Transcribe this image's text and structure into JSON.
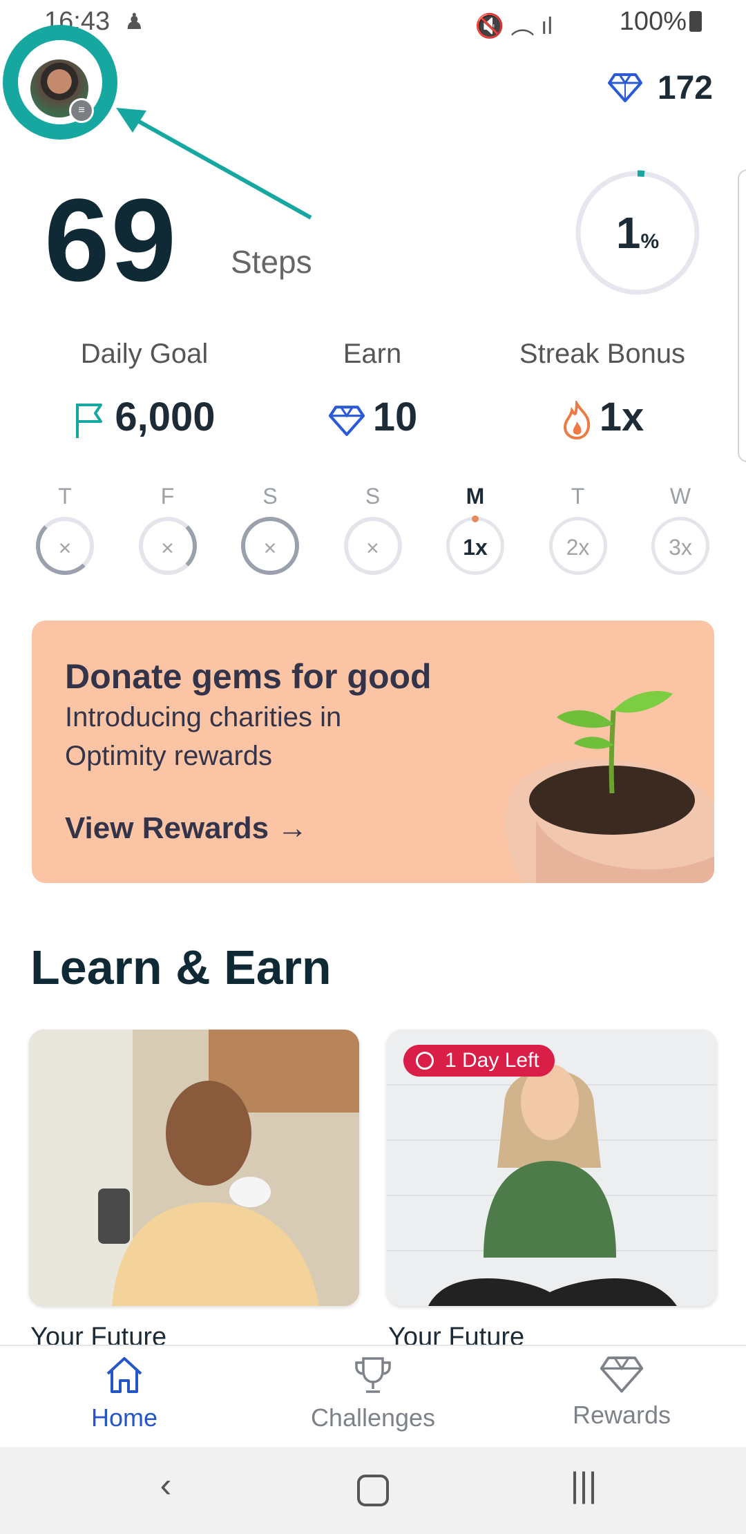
{
  "status_bar": {
    "time": "16:43",
    "battery": "100%"
  },
  "header": {
    "gems": "172"
  },
  "steps": {
    "count": "69",
    "label": "Steps",
    "progress_value": "1",
    "progress_unit": "%",
    "progress_fraction": 0.01
  },
  "stats": [
    {
      "label": "Daily Goal",
      "value": "6,000",
      "icon": "flag-icon"
    },
    {
      "label": "Earn",
      "value": "10",
      "icon": "gem-icon"
    },
    {
      "label": "Streak Bonus",
      "value": "1x",
      "icon": "flame-icon"
    }
  ],
  "week": [
    {
      "letter": "T",
      "mark": "×"
    },
    {
      "letter": "F",
      "mark": "×"
    },
    {
      "letter": "S",
      "mark": "×"
    },
    {
      "letter": "S",
      "mark": "×"
    },
    {
      "letter": "M",
      "mark": "1x"
    },
    {
      "letter": "T",
      "mark": "2x"
    },
    {
      "letter": "W",
      "mark": "3x"
    }
  ],
  "banner": {
    "title": "Donate gems for good",
    "subtitle": "Introducing charities in Optimity rewards",
    "cta": "View Rewards →"
  },
  "learn": {
    "title": "Learn & Earn",
    "cards": [
      {
        "caption": "Your Future"
      },
      {
        "caption": "Your Future",
        "badge": "1 Day Left"
      }
    ]
  },
  "nav": {
    "home": "Home",
    "challenges": "Challenges",
    "rewards": "Rewards"
  },
  "colors": {
    "teal": "#16a7a1",
    "nav_active": "#2456c7",
    "banner_bg": "#fbc4a4",
    "badge_red": "#d91e48"
  }
}
